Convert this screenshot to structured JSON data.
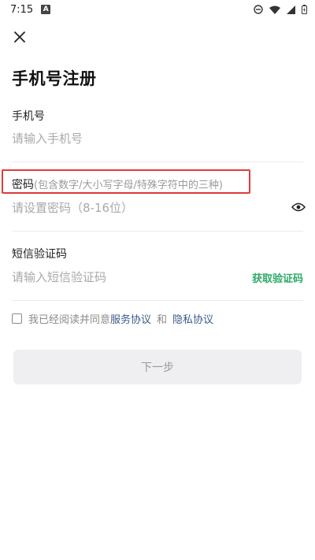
{
  "status_bar": {
    "time": "7:15",
    "notification_letter": "A"
  },
  "header": {
    "title": "手机号注册"
  },
  "phone": {
    "label": "手机号",
    "placeholder": "请输入手机号"
  },
  "password": {
    "label": "密码",
    "hint": "(包含数字/大小写字母/特殊字符中的三种)",
    "placeholder": "请设置密码（8-16位）"
  },
  "sms": {
    "label": "短信验证码",
    "placeholder": "请输入短信验证码",
    "get_code_label": "获取验证码"
  },
  "agreement": {
    "prefix": "我已经阅读并同意",
    "service_link": "服务协议",
    "and": "和",
    "privacy_link": "隐私协议"
  },
  "actions": {
    "next_label": "下一步"
  },
  "colors": {
    "accent_green": "#2eaa68",
    "link_blue": "#3a5b8c",
    "highlight_red": "#e03a3a",
    "button_disabled_bg": "#efeff1"
  }
}
